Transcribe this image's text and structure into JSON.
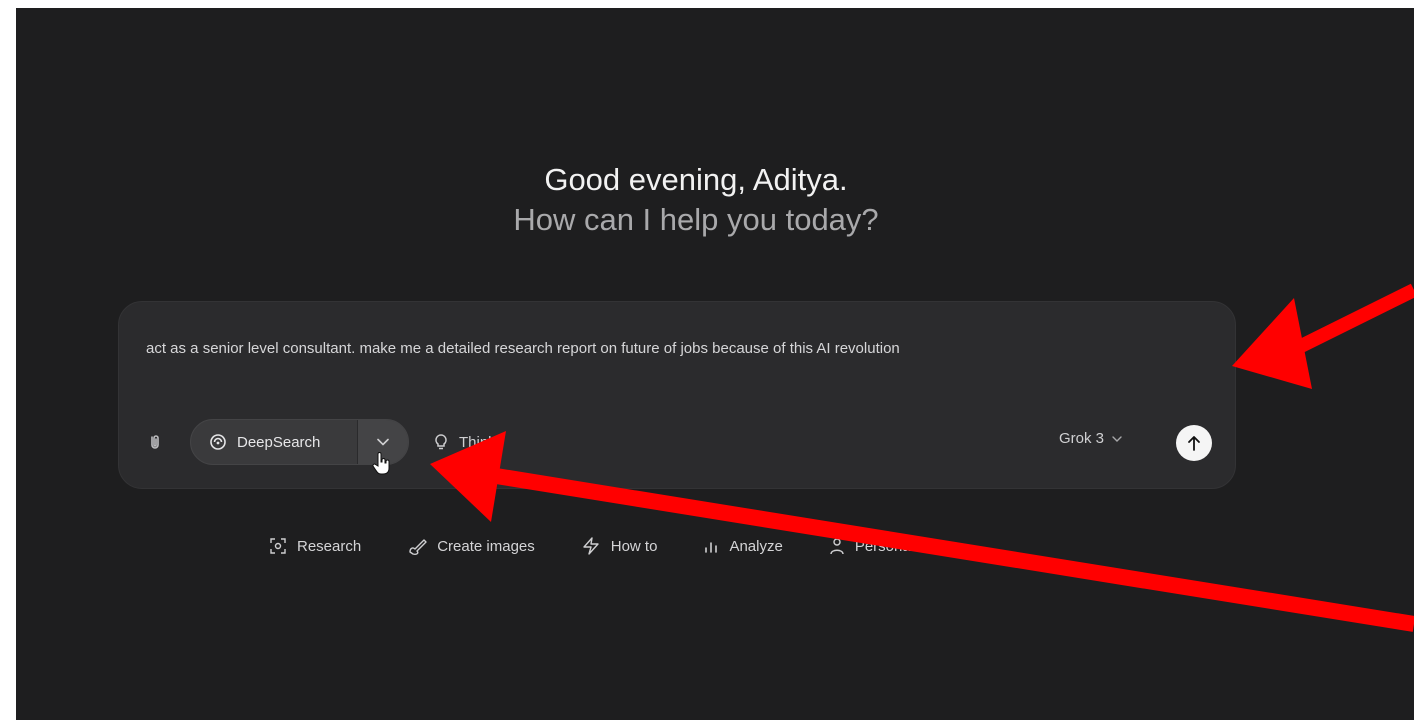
{
  "greeting": {
    "title": "Good evening, Aditya.",
    "subtitle": "How can I help you today?"
  },
  "composer": {
    "text": "act as a senior level consultant. make me a detailed research report on future of jobs because of this AI revolution",
    "deepsearch_label": "DeepSearch",
    "think_label": "Think",
    "model_label": "Grok 3"
  },
  "quick_actions": [
    {
      "label": "Research",
      "icon": "research-icon"
    },
    {
      "label": "Create images",
      "icon": "brush-icon"
    },
    {
      "label": "How to",
      "icon": "bolt-icon"
    },
    {
      "label": "Analyze",
      "icon": "chart-icon"
    },
    {
      "label": "Personas",
      "icon": "person-icon"
    }
  ],
  "colors": {
    "background": "#1e1e1f",
    "composer": "#2b2b2d",
    "annotation_arrow": "#ff0000"
  }
}
